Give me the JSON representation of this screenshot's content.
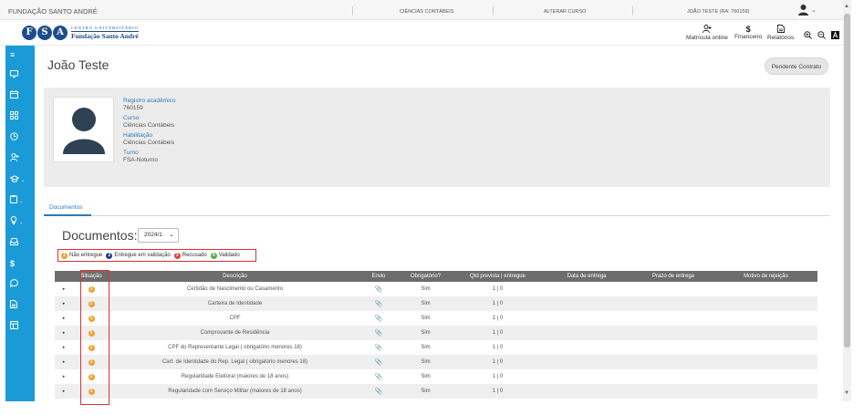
{
  "topbar": {
    "institution": "FUNDAÇÃO SANTO ANDRÉ",
    "course": "CIÊNCIAS CONTÁBEIS",
    "alter_course": "ALTERAR CURSO",
    "user": "JOÃO TESTE (RA: 760159)"
  },
  "header": {
    "logo_letters": [
      "F",
      "S",
      "A"
    ],
    "logo_line1": "CENTRO UNIVERSITÁRIO",
    "logo_line2": "Fundação Santo André",
    "nav": [
      {
        "icon": "user-add-icon",
        "label": "Matrícula online"
      },
      {
        "icon": "dollar-icon",
        "label": "Financeiro"
      },
      {
        "icon": "document-icon",
        "label": "Relatórios"
      }
    ]
  },
  "sidebar": {
    "items": [
      {
        "icon": "menu-icon"
      },
      {
        "icon": "monitor-icon"
      },
      {
        "icon": "calendar-icon"
      },
      {
        "icon": "grid-icon"
      },
      {
        "icon": "clock-icon"
      },
      {
        "icon": "user-add-icon"
      },
      {
        "icon": "graduation-cap-icon",
        "dropdown": true
      },
      {
        "icon": "clipboard-icon",
        "dropdown": true
      },
      {
        "icon": "lightbulb-icon",
        "dropdown": true
      },
      {
        "icon": "inbox-icon"
      },
      {
        "icon": "dollar-icon"
      },
      {
        "icon": "chat-icon"
      },
      {
        "icon": "document-icon"
      },
      {
        "icon": "layout-icon"
      }
    ]
  },
  "main": {
    "title": "João Teste",
    "pending_button": "Pendente Contrato",
    "profile": {
      "fields": [
        {
          "label": "Registro acadêmico",
          "value": "760159"
        },
        {
          "label": "Curso",
          "value": "Ciências Contábeis"
        },
        {
          "label": "Habilitação",
          "value": "Ciências Contábeis"
        },
        {
          "label": "Turno",
          "value": "FSA-Noturno"
        }
      ]
    },
    "tabs": [
      {
        "label": "Documentos",
        "active": true
      }
    ],
    "documents_title": "Documentos:",
    "year_selected": "2024/1",
    "legend": [
      {
        "number": "1",
        "label": "Não entregue",
        "color": "#f0a030"
      },
      {
        "number": "2",
        "label": "Entregue em validação",
        "color": "#1e3c8c"
      },
      {
        "number": "3",
        "label": "Recusado",
        "color": "#e04040"
      },
      {
        "number": "4",
        "label": "Validado",
        "color": "#4caf50"
      }
    ],
    "table": {
      "headers": [
        "",
        "Situação",
        "Descrição",
        "Envio",
        "Obrigatório?",
        "Qtd prevista | entregue",
        "Data de entrega",
        "Prazo de entrega",
        "Motivo de rejeição"
      ],
      "rows": [
        {
          "status": "1",
          "description": "Certidão de Nascimento ou Casamento",
          "required": "Sim",
          "qty": "1 | 0",
          "date": "",
          "deadline": "",
          "reason": ""
        },
        {
          "status": "1",
          "description": "Carteira de Identidade",
          "required": "Sim",
          "qty": "1 | 0",
          "date": "",
          "deadline": "",
          "reason": ""
        },
        {
          "status": "1",
          "description": "CPF",
          "required": "Sim",
          "qty": "1 | 0",
          "date": "",
          "deadline": "",
          "reason": ""
        },
        {
          "status": "1",
          "description": "Comprovante de Residência",
          "required": "Sim",
          "qty": "1 | 0",
          "date": "",
          "deadline": "",
          "reason": ""
        },
        {
          "status": "1",
          "description": "CPF do Representante Legal ( obrigatório menores 18)",
          "required": "Sim",
          "qty": "1 | 0",
          "date": "",
          "deadline": "",
          "reason": ""
        },
        {
          "status": "1",
          "description": "Cart. de Identidade do Rep. Legal ( obrigatório menores 18)",
          "required": "Sim",
          "qty": "1 | 0",
          "date": "",
          "deadline": "",
          "reason": ""
        },
        {
          "status": "1",
          "description": "Regularidade Eleitoral (maiores de 18 anos)",
          "required": "Sim",
          "qty": "1 | 0",
          "date": "",
          "deadline": "",
          "reason": ""
        },
        {
          "status": "1",
          "description": "Regularidade com Serviço Militar (maiores de 18 anos)",
          "required": "Sim",
          "qty": "1 | 0",
          "date": "",
          "deadline": "",
          "reason": ""
        }
      ]
    }
  }
}
